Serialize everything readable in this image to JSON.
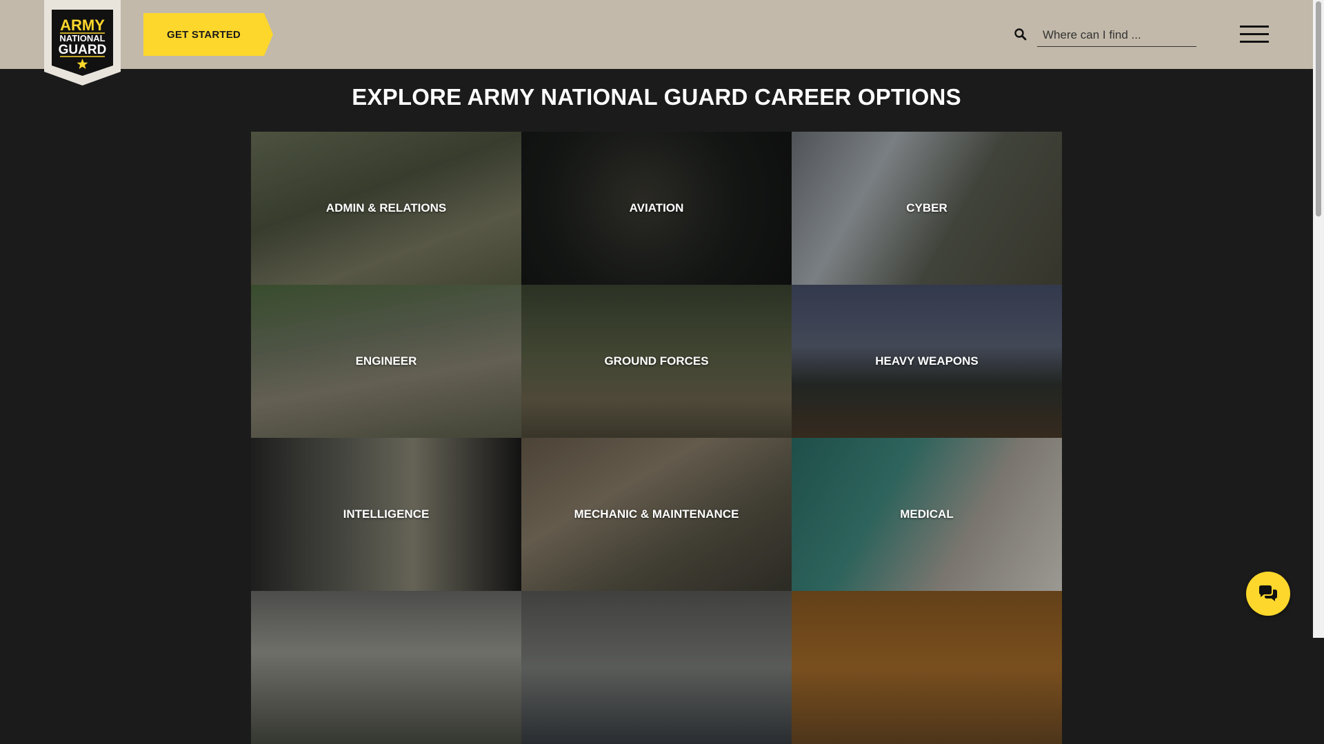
{
  "header": {
    "logo": {
      "line1": "ARMY",
      "line2": "NATIONAL",
      "line3": "GUARD"
    },
    "get_started_label": "GET STARTED",
    "search": {
      "placeholder": "Where can I find ...",
      "value": ""
    },
    "icons": {
      "search": "search-icon",
      "menu": "hamburger-menu-icon",
      "logo_star": "star-icon"
    }
  },
  "main": {
    "title": "EXPLORE ARMY NATIONAL GUARD CAREER OPTIONS",
    "tiles": [
      {
        "label": "ADMIN & RELATIONS"
      },
      {
        "label": "AVIATION"
      },
      {
        "label": "CYBER"
      },
      {
        "label": "ENGINEER"
      },
      {
        "label": "GROUND FORCES"
      },
      {
        "label": "HEAVY WEAPONS"
      },
      {
        "label": "INTELLIGENCE"
      },
      {
        "label": "MECHANIC & MAINTENANCE"
      },
      {
        "label": "MEDICAL"
      },
      {
        "label": ""
      },
      {
        "label": ""
      },
      {
        "label": ""
      }
    ]
  },
  "chat": {
    "icon": "chat-bubbles-icon"
  },
  "colors": {
    "header_bg": "#c2b9aa",
    "page_bg": "#1b1b1b",
    "accent_yellow": "#fdd72b",
    "text_light": "#ffffff"
  }
}
